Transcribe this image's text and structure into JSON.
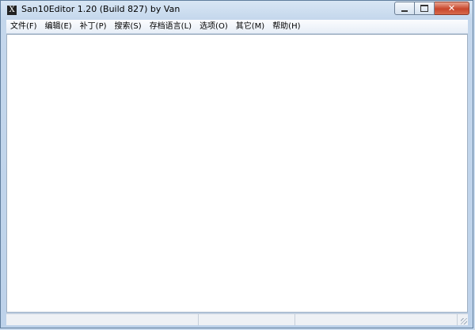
{
  "window": {
    "title": "San10Editor 1.20 (Build 827) by Van",
    "icon_glyph": "X",
    "icon_name": "app-icon",
    "controls": {
      "minimize_icon": "minimize-icon",
      "maximize_icon": "maximize-icon",
      "close_icon": "close-icon",
      "close_glyph": "✕"
    }
  },
  "menubar": {
    "items": [
      {
        "label": "文件(F)"
      },
      {
        "label": "编辑(E)"
      },
      {
        "label": "补丁(P)"
      },
      {
        "label": "搜索(S)"
      },
      {
        "label": "存档语言(L)"
      },
      {
        "label": "选项(O)"
      },
      {
        "label": "其它(M)"
      },
      {
        "label": "帮助(H)"
      }
    ]
  },
  "colors": {
    "close_button": "#c8462c",
    "client_background": "#ffffff",
    "frame": "#c4d7ec"
  }
}
